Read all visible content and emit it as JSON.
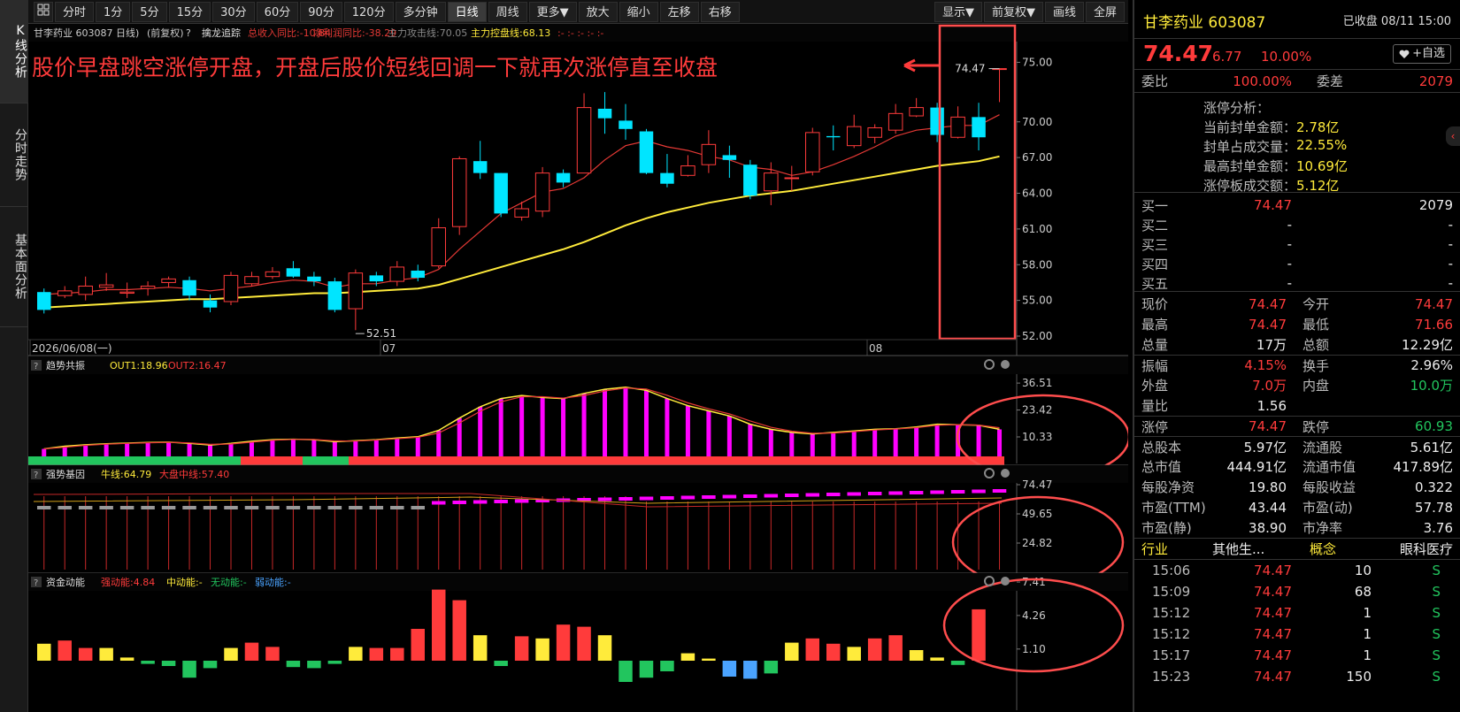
{
  "left_tabs": [
    "K线分析",
    "分时走势",
    "基本面分析"
  ],
  "toolbar": {
    "icon_grid": "grid-icon",
    "left_buttons": [
      "分时",
      "1分",
      "5分",
      "15分",
      "30分",
      "60分",
      "90分",
      "120分",
      "多分钟",
      "日线",
      "周线",
      "更多▼",
      "放大",
      "缩小",
      "左移",
      "右移"
    ],
    "active_button": "日线",
    "right_buttons": [
      "显示▼",
      "前复权▼",
      "画线",
      "全屏"
    ]
  },
  "chart_header": {
    "title": "甘李药业 603087 日线)",
    "adjust": "(前复权)",
    "help": "?",
    "indicator_name": "擒龙追踪",
    "revenue_yoy": "总收入同比:-10.84",
    "profit_yoy": "净利润同比:-38.29",
    "attack_line": "主力攻击线:70.05",
    "control_line": "主力控盘线:68.13",
    "tail": ":- :- :- :- :-"
  },
  "annotation": {
    "text": "股价早盘跳空涨停开盘，开盘后股价短线回调一下就再次涨停直至收盘",
    "arrow": "left-arrow-icon",
    "color": "#ff3b3b"
  },
  "main_chart": {
    "price_axis": [
      "75.00",
      "70.00",
      "67.00",
      "64.00",
      "61.00",
      "58.00",
      "55.00",
      "52.00"
    ],
    "date_axis": [
      "2026/06/08(一)",
      "07",
      "08"
    ],
    "high_label": "74.47",
    "low_label": "52.51"
  },
  "panel1": {
    "help": "?",
    "name": "趋势共振",
    "out1": "OUT1:18.96",
    "out2": "OUT2:16.47",
    "axis": [
      "36.51",
      "23.42",
      "10.33"
    ]
  },
  "panel2": {
    "help": "?",
    "name": "强势基因",
    "line1": "牛线:64.79",
    "line2": "大盘中线:57.40",
    "axis": [
      "74.47",
      "49.65",
      "24.82"
    ]
  },
  "panel3": {
    "help": "?",
    "name": "资金动能",
    "strong": "强动能:4.84",
    "mid": "中动能:-",
    "none": "无动能:-",
    "weak": "弱动能:-",
    "axis": [
      "7.41",
      "4.26",
      "1.10"
    ]
  },
  "stock": {
    "name_code": "甘李药业 603087",
    "status": "已收盘 08/11 15:00",
    "price": "74.47",
    "change": "6.77",
    "change_pct": "10.00%",
    "watch_button": "+自选",
    "heart_icon": "heart-icon",
    "weibi_label": "委比",
    "weibi": "100.00%",
    "weicha_label": "委差",
    "weicha": "2079"
  },
  "limit_analysis": {
    "title": "涨停分析：",
    "rows": [
      {
        "label": "当前封单金额：",
        "value": "2.78亿"
      },
      {
        "label": "封单占成交量：",
        "value": "22.55%"
      },
      {
        "label": "最高封单金额：",
        "value": "10.69亿"
      },
      {
        "label": "涨停板成交额：",
        "value": "5.12亿"
      }
    ]
  },
  "order_book": [
    {
      "label": "买一",
      "price": "74.47",
      "vol": "2079"
    },
    {
      "label": "买二",
      "price": "-",
      "vol": "-"
    },
    {
      "label": "买三",
      "price": "-",
      "vol": "-"
    },
    {
      "label": "买四",
      "price": "-",
      "vol": "-"
    },
    {
      "label": "买五",
      "price": "-",
      "vol": "-"
    }
  ],
  "quote": [
    [
      {
        "l": "现价",
        "v": "74.47",
        "c": "red"
      },
      {
        "l": "今开",
        "v": "74.47",
        "c": "red"
      }
    ],
    [
      {
        "l": "最高",
        "v": "74.47",
        "c": "red"
      },
      {
        "l": "最低",
        "v": "71.66",
        "c": "red"
      }
    ],
    [
      {
        "l": "总量",
        "v": "17万",
        "c": "white"
      },
      {
        "l": "总额",
        "v": "12.29亿",
        "c": "white"
      }
    ],
    [
      {
        "l": "振幅",
        "v": "4.15%",
        "c": "red"
      },
      {
        "l": "换手",
        "v": "2.96%",
        "c": "white"
      }
    ],
    [
      {
        "l": "外盘",
        "v": "7.0万",
        "c": "red"
      },
      {
        "l": "内盘",
        "v": "10.0万",
        "c": "green"
      }
    ],
    [
      {
        "l": "量比",
        "v": "1.56",
        "c": "white"
      },
      {
        "l": "",
        "v": "",
        "c": "white"
      }
    ],
    [
      {
        "l": "涨停",
        "v": "74.47",
        "c": "red"
      },
      {
        "l": "跌停",
        "v": "60.93",
        "c": "green"
      }
    ],
    [
      {
        "l": "总股本",
        "v": "5.97亿",
        "c": "white"
      },
      {
        "l": "流通股",
        "v": "5.61亿",
        "c": "white"
      }
    ],
    [
      {
        "l": "总市值",
        "v": "444.91亿",
        "c": "white"
      },
      {
        "l": "流通市值",
        "v": "417.89亿",
        "c": "white"
      }
    ],
    [
      {
        "l": "每股净资",
        "v": "19.80",
        "c": "white"
      },
      {
        "l": "每股收益",
        "v": "0.322",
        "c": "white"
      }
    ],
    [
      {
        "l": "市盈(TTM)",
        "v": "43.44",
        "c": "white"
      },
      {
        "l": "市盈(动)",
        "v": "57.78",
        "c": "white"
      }
    ],
    [
      {
        "l": "市盈(静)",
        "v": "38.90",
        "c": "white"
      },
      {
        "l": "市净率",
        "v": "3.76",
        "c": "white"
      }
    ]
  ],
  "industry": {
    "label": "行业",
    "value": "其他生...",
    "concept_label": "概念",
    "concept": "眼科医疗"
  },
  "ticks": [
    {
      "t": "15:06",
      "p": "74.47",
      "v": "10",
      "d": "S"
    },
    {
      "t": "15:09",
      "p": "74.47",
      "v": "68",
      "d": "S"
    },
    {
      "t": "15:12",
      "p": "74.47",
      "v": "1",
      "d": "S"
    },
    {
      "t": "15:12",
      "p": "74.47",
      "v": "1",
      "d": "S"
    },
    {
      "t": "15:17",
      "p": "74.47",
      "v": "1",
      "d": "S"
    },
    {
      "t": "15:23",
      "p": "74.47",
      "v": "150",
      "d": "S"
    }
  ],
  "colors": {
    "up": "#ff3b3b",
    "down": "#00e5ff",
    "ma_red": "#e53935",
    "ma_yellow": "#ffeb3b",
    "magenta": "#ff00ff",
    "green": "#22c55e"
  },
  "chart_data": [
    {
      "type": "candlestick",
      "title": "甘李药业 603087 日线",
      "candles": [
        [
          55.7,
          54.2,
          56.0,
          53.9
        ],
        [
          55.4,
          55.8,
          56.2,
          55.2
        ],
        [
          55.5,
          56.2,
          57.0,
          55.0
        ],
        [
          56.1,
          56.3,
          57.3,
          55.8
        ],
        [
          55.6,
          55.7,
          56.5,
          55.2
        ],
        [
          56.0,
          56.2,
          56.6,
          55.4
        ],
        [
          56.5,
          56.8,
          57.0,
          56.1
        ],
        [
          56.7,
          55.4,
          57.0,
          55.0
        ],
        [
          55.0,
          54.4,
          55.5,
          54.0
        ],
        [
          54.9,
          57.1,
          57.4,
          54.6
        ],
        [
          56.4,
          57.0,
          57.4,
          56.2
        ],
        [
          57.0,
          57.4,
          57.8,
          56.8
        ],
        [
          57.7,
          57.0,
          58.3,
          56.9
        ],
        [
          57.0,
          56.6,
          57.4,
          56.2
        ],
        [
          56.6,
          54.2,
          56.9,
          54.0
        ],
        [
          54.3,
          57.3,
          57.6,
          52.5
        ],
        [
          57.1,
          56.6,
          57.4,
          56.2
        ],
        [
          56.6,
          57.8,
          58.3,
          56.2
        ],
        [
          57.5,
          56.9,
          58.0,
          56.6
        ],
        [
          57.9,
          61.1,
          61.9,
          57.7
        ],
        [
          61.2,
          66.9,
          67.1,
          60.5
        ],
        [
          66.7,
          65.7,
          68.4,
          65.2
        ],
        [
          65.7,
          62.3,
          65.7,
          62.0
        ],
        [
          62.0,
          62.7,
          63.3,
          61.7
        ],
        [
          62.5,
          65.7,
          66.2,
          62.0
        ],
        [
          65.7,
          64.9,
          66.0,
          64.5
        ],
        [
          65.7,
          71.2,
          72.4,
          65.7
        ],
        [
          71.1,
          70.3,
          72.5,
          69.0
        ],
        [
          70.1,
          69.4,
          71.5,
          68.5
        ],
        [
          69.2,
          65.7,
          69.4,
          65.6
        ],
        [
          65.7,
          64.8,
          67.3,
          64.5
        ],
        [
          65.5,
          66.3,
          67.2,
          65.4
        ],
        [
          66.4,
          68.1,
          69.3,
          65.7
        ],
        [
          67.2,
          66.8,
          68.0,
          65.3
        ],
        [
          66.4,
          63.8,
          66.8,
          63.5
        ],
        [
          64.2,
          65.7,
          66.6,
          63.0
        ],
        [
          65.3,
          65.3,
          66.3,
          64.2
        ],
        [
          65.8,
          69.1,
          69.5,
          65.5
        ],
        [
          68.8,
          68.7,
          69.7,
          67.6
        ],
        [
          68.0,
          69.6,
          70.6,
          67.8
        ],
        [
          68.7,
          69.5,
          69.8,
          68.2
        ],
        [
          69.3,
          70.7,
          71.5,
          69.0
        ],
        [
          70.5,
          71.2,
          72.0,
          70.4
        ],
        [
          71.2,
          68.9,
          71.6,
          68.3
        ],
        [
          68.7,
          70.4,
          71.3,
          68.6
        ],
        [
          70.4,
          68.7,
          71.6,
          67.6
        ],
        [
          74.47,
          74.47,
          74.47,
          71.66
        ]
      ],
      "ma_red": [
        55.5,
        55.6,
        55.7,
        55.9,
        55.9,
        56.0,
        56.1,
        56.0,
        55.8,
        56.0,
        56.2,
        56.5,
        56.7,
        56.6,
        56.1,
        56.4,
        56.4,
        56.7,
        56.9,
        57.6,
        59.3,
        60.8,
        62.3,
        63.2,
        64.1,
        64.4,
        65.3,
        66.8,
        68.0,
        68.4,
        67.9,
        67.6,
        67.1,
        66.8,
        66.2,
        66.0,
        65.5,
        65.8,
        66.4,
        67.1,
        67.9,
        68.8,
        69.3,
        69.5,
        69.7,
        69.7,
        70.6
      ],
      "ma_yellow": [
        54.4,
        54.5,
        54.6,
        54.7,
        54.8,
        54.9,
        55.0,
        55.1,
        55.1,
        55.2,
        55.3,
        55.4,
        55.5,
        55.6,
        55.6,
        55.7,
        55.8,
        55.9,
        56.0,
        56.3,
        56.8,
        57.3,
        57.8,
        58.3,
        58.8,
        59.3,
        59.9,
        60.6,
        61.3,
        61.9,
        62.4,
        62.8,
        63.2,
        63.5,
        63.8,
        64.0,
        64.2,
        64.5,
        64.8,
        65.1,
        65.4,
        65.7,
        66.0,
        66.3,
        66.5,
        66.7,
        67.1
      ],
      "ylim": [
        52.0,
        76.0
      ]
    },
    {
      "type": "bar",
      "title": "趋势共振",
      "values": [
        4.5,
        5.8,
        6.5,
        7.0,
        7.3,
        7.6,
        7.8,
        7.2,
        6.4,
        7.2,
        8.2,
        9.0,
        9.2,
        9.0,
        8.0,
        8.5,
        9.0,
        9.8,
        10.4,
        13.5,
        19.5,
        25.0,
        29.0,
        30.5,
        29.5,
        29.0,
        31.5,
        33.5,
        34.5,
        33.0,
        29.0,
        25.5,
        23.0,
        20.5,
        16.5,
        14.0,
        12.5,
        11.8,
        12.5,
        13.2,
        14.0,
        14.3,
        15.2,
        16.5,
        16.2,
        16.0,
        14.0,
        18.96
      ],
      "ylim": [
        0,
        40
      ]
    },
    {
      "type": "bar",
      "title": "资金动能",
      "values": [
        1.6,
        1.9,
        1.2,
        1.2,
        0.3,
        -0.3,
        -0.5,
        -1.6,
        -0.7,
        1.2,
        1.7,
        1.3,
        -0.6,
        -0.7,
        -0.3,
        1.3,
        1.2,
        1.2,
        3.0,
        6.7,
        5.7,
        2.4,
        -0.5,
        2.3,
        2.1,
        3.4,
        3.2,
        2.4,
        -2.0,
        -1.6,
        -1.0,
        0.7,
        0.2,
        -1.5,
        -1.7,
        -1.2,
        1.7,
        2.1,
        1.6,
        1.3,
        2.1,
        2.4,
        1.0,
        0.3,
        -0.4,
        4.84
      ],
      "ylim": [
        -2.5,
        7.41
      ]
    }
  ]
}
